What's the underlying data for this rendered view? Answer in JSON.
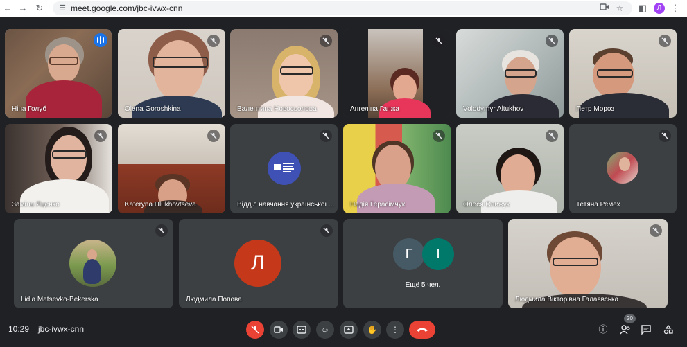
{
  "browser": {
    "url": "meet.google.com/jbc-ivwx-cnn",
    "profile_initial": "Л",
    "icons": [
      "back-icon",
      "forward-icon",
      "reload-icon",
      "tune-icon",
      "camera-blocked-icon",
      "star-icon",
      "sidebar-icon",
      "menu-icon"
    ]
  },
  "tiles": [
    {
      "name": "Ніна Голуб",
      "speaking": true,
      "kind": "video"
    },
    {
      "name": "Olena Goroshkina",
      "kind": "video"
    },
    {
      "name": "Валентина Новосьолова",
      "kind": "video"
    },
    {
      "name": "Ангеліна Ганжа",
      "kind": "video"
    },
    {
      "name": "Volodymyr Altukhov",
      "kind": "video"
    },
    {
      "name": "Петр Мороз",
      "kind": "video"
    },
    {
      "name": "Заміла Яценко",
      "kind": "video"
    },
    {
      "name": "Kateryna Hlukhovtseva",
      "kind": "video"
    },
    {
      "name": "Відділ навчання української ...",
      "kind": "logo"
    },
    {
      "name": "Надія Герасімчук",
      "kind": "video"
    },
    {
      "name": "Олеся Слижук",
      "kind": "video"
    },
    {
      "name": "Тетяна Ремех",
      "kind": "photo"
    },
    {
      "name": "Lidia Matsevko-Bekerska",
      "kind": "photo"
    },
    {
      "name": "Людмила Попова",
      "kind": "letter",
      "letter": "Л"
    },
    {
      "name": "Ещё 5 чел.",
      "kind": "group",
      "letters": [
        "Г",
        "І"
      ]
    },
    {
      "name": "Людмила Вікторівна Галаєвська",
      "kind": "video"
    }
  ],
  "bottom": {
    "time": "10:29",
    "meeting_code": "jbc-ivwx-cnn",
    "participants_count": "20",
    "controls": [
      "mic-off-icon",
      "camera-icon",
      "captions-icon",
      "emoji-icon",
      "present-icon",
      "raise-hand-icon",
      "more-options-icon",
      "end-call-icon"
    ],
    "right_controls": [
      "info-icon",
      "people-icon",
      "chat-icon",
      "activities-icon"
    ]
  },
  "colors": {
    "accent": "#1a73e8",
    "danger": "#ea4335",
    "background": "#202124",
    "tile": "#3c4043"
  }
}
